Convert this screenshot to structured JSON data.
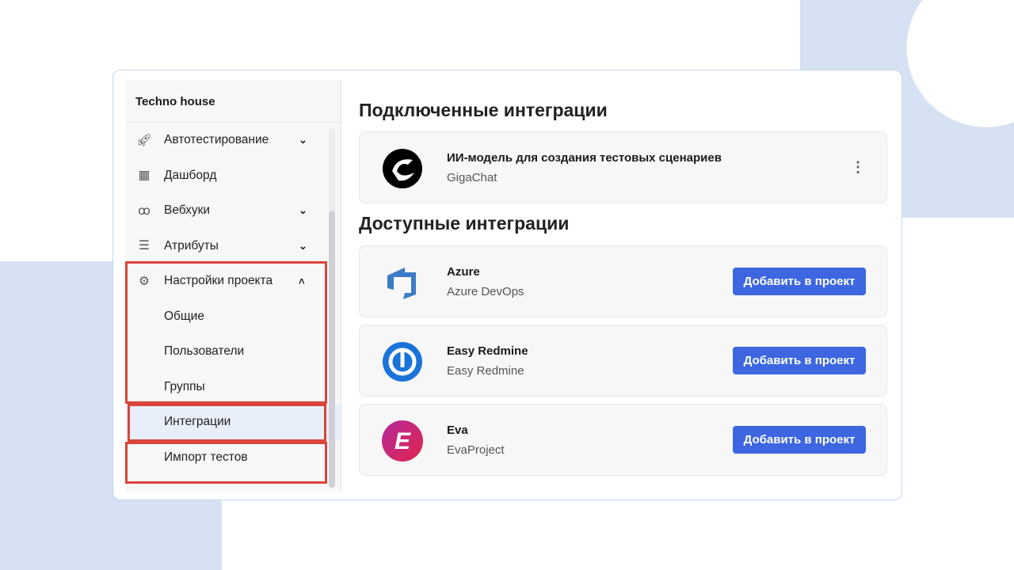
{
  "sidebar": {
    "project": "Techno house",
    "items": [
      {
        "label": "Автотестирование",
        "icon": "rocket-icon"
      },
      {
        "label": "Дашборд",
        "icon": "dashboard-icon"
      },
      {
        "label": "Вебхуки",
        "icon": "webhook-icon"
      },
      {
        "label": "Атрибуты",
        "icon": "attributes-icon"
      },
      {
        "label": "Настройки проекта",
        "icon": "gear-icon"
      }
    ],
    "sub": [
      "Общие",
      "Пользователи",
      "Группы",
      "Интеграции",
      "Импорт тестов"
    ]
  },
  "main": {
    "connected_title": "Подключенные интеграции",
    "available_title": "Доступные интеграции",
    "connected": [
      {
        "title": "ИИ-модель для создания тестовых сценариев",
        "subtitle": "GigaChat"
      }
    ],
    "available": [
      {
        "title": "Azure",
        "subtitle": "Azure DevOps",
        "button": "Добавить в проект"
      },
      {
        "title": "Easy Redmine",
        "subtitle": "Easy Redmine",
        "button": "Добавить в проект"
      },
      {
        "title": "Eva",
        "subtitle": "EvaProject",
        "button": "Добавить в проект"
      }
    ],
    "eva_logo_letter": "E"
  },
  "colors": {
    "accent": "#3d66e0",
    "highlight": "#d9443b"
  }
}
